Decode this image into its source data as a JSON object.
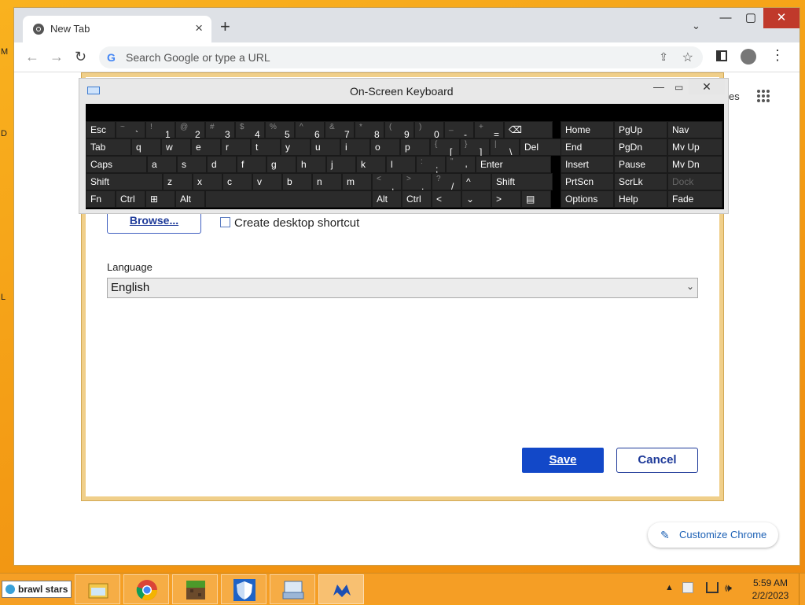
{
  "desktop": {
    "edge_letters": [
      "M",
      "D",
      "L"
    ]
  },
  "browser": {
    "tab": {
      "title": "New Tab",
      "close": "×"
    },
    "new_tab": "+",
    "tab_search": "⌄",
    "window": {
      "minimize": "—",
      "maximize": "▢",
      "close": "✕"
    },
    "toolbar": {
      "back": "←",
      "forward": "→",
      "reload": "↻",
      "omnibox_placeholder": "Search Google or type a URL",
      "share": "⇪",
      "star": "☆",
      "menu": "⋮"
    },
    "apps": "• • •\n• • •\n• • •",
    "cut_text": "es",
    "customize_label": "Customize Chrome"
  },
  "dialog": {
    "browse_label": "Browse...",
    "shortcut_label": "Create desktop shortcut",
    "language_label": "Language",
    "language_value": "English",
    "save_label": "Save",
    "cancel_label": "Cancel"
  },
  "osk": {
    "title": "On-Screen Keyboard",
    "min": "—",
    "max": "▭",
    "close": "✕",
    "rows": [
      [
        [
          "Esc",
          ""
        ],
        [
          "`",
          "~"
        ],
        [
          "1",
          "!"
        ],
        [
          "2",
          "@"
        ],
        [
          "3",
          "#"
        ],
        [
          "4",
          "$"
        ],
        [
          "5",
          "%"
        ],
        [
          "6",
          "^"
        ],
        [
          "7",
          "&"
        ],
        [
          "8",
          "*"
        ],
        [
          "9",
          "("
        ],
        [
          "0",
          ")"
        ],
        [
          "-",
          "_"
        ],
        [
          "=",
          "+"
        ],
        [
          "⌫",
          ""
        ]
      ],
      [
        [
          "Tab",
          ""
        ],
        [
          "q",
          ""
        ],
        [
          "w",
          ""
        ],
        [
          "e",
          ""
        ],
        [
          "r",
          ""
        ],
        [
          "t",
          ""
        ],
        [
          "y",
          ""
        ],
        [
          "u",
          ""
        ],
        [
          "i",
          ""
        ],
        [
          "o",
          ""
        ],
        [
          "p",
          ""
        ],
        [
          "[",
          "{"
        ],
        [
          "]",
          "}"
        ],
        [
          "\\",
          "|"
        ],
        [
          "Del",
          ""
        ]
      ],
      [
        [
          "Caps",
          ""
        ],
        [
          "a",
          ""
        ],
        [
          "s",
          ""
        ],
        [
          "d",
          ""
        ],
        [
          "f",
          ""
        ],
        [
          "g",
          ""
        ],
        [
          "h",
          ""
        ],
        [
          "j",
          ""
        ],
        [
          "k",
          ""
        ],
        [
          "l",
          ""
        ],
        [
          ";",
          ":"
        ],
        [
          "'",
          "\""
        ],
        [
          "Enter",
          ""
        ]
      ],
      [
        [
          "Shift",
          ""
        ],
        [
          "z",
          ""
        ],
        [
          "x",
          ""
        ],
        [
          "c",
          ""
        ],
        [
          "v",
          ""
        ],
        [
          "b",
          ""
        ],
        [
          "n",
          ""
        ],
        [
          "m",
          ""
        ],
        [
          ",",
          "<"
        ],
        [
          ".",
          ">"
        ],
        [
          "/",
          "?"
        ],
        [
          "^",
          ""
        ],
        [
          "Shift",
          ""
        ]
      ],
      [
        [
          "Fn",
          ""
        ],
        [
          "Ctrl",
          ""
        ],
        [
          "⊞",
          ""
        ],
        [
          "Alt",
          ""
        ],
        [
          "",
          ""
        ],
        [
          "Alt",
          ""
        ],
        [
          "Ctrl",
          ""
        ],
        [
          "<",
          ""
        ],
        [
          "⌄",
          ""
        ],
        [
          ">",
          ""
        ],
        [
          "▤",
          ""
        ]
      ]
    ],
    "nav_keys": [
      [
        "Home",
        "PgUp",
        "Nav"
      ],
      [
        "End",
        "PgDn",
        "Mv Up"
      ],
      [
        "Insert",
        "Pause",
        "Mv Dn"
      ],
      [
        "PrtScn",
        "ScrLk",
        "Dock"
      ],
      [
        "Options",
        "Help",
        "Fade"
      ]
    ]
  },
  "taskbar": {
    "search_text": "brawl stars",
    "items": [
      "file-explorer",
      "chrome",
      "minecraft",
      "defender",
      "onscreen-keyboard",
      "app"
    ],
    "tray": {
      "up": "▲",
      "volume": "🕪"
    },
    "time": "5:59 AM",
    "date": "2/2/2023"
  }
}
